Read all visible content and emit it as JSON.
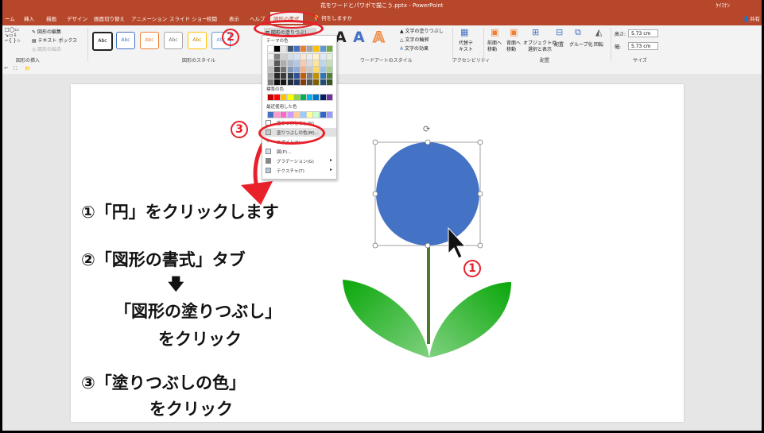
{
  "window": {
    "title": "花をワードとパワポで描こう.pptx  -  PowerPoint",
    "user": "ｹｲﾏﾅﾝ",
    "share": "共有"
  },
  "tabs": [
    "ーム",
    "挿入",
    "描画",
    "デザイン",
    "画面切り替え",
    "アニメーション",
    "スライド ショー",
    "校閲",
    "表示",
    "ヘルプ",
    "図形の書式"
  ],
  "tell_me": "何をしますか",
  "ribbon": {
    "insert_shapes": {
      "edit_shape": "図形の編集",
      "text_box": "テキスト ボックス",
      "merge": "図形の結合",
      "label": "図形の挿入"
    },
    "shape_styles": {
      "style_text": "Abc",
      "label": "図形のスタイル"
    },
    "fill_button": "図形の塗りつぶし",
    "wordart": {
      "fill": "文字の塗りつぶし",
      "outline": "文字の輪郭",
      "effects": "文字の効果",
      "label": "ワードアートのスタイル",
      "letter": "A"
    },
    "accessibility": {
      "alt_text": "代替テ\nキスト",
      "label": "アクセシビリティ"
    },
    "arrange": {
      "forward": "前面へ\n移動",
      "backward": "背面へ\n移動",
      "selection": "オブジェクトの\n選択と表示",
      "align": "配置",
      "group": "グループ化",
      "rotate": "回転",
      "label": "配置"
    },
    "size": {
      "height_label": "高さ:",
      "height": "5.73 cm",
      "width_label": "幅:",
      "width": "5.73 cm",
      "label": "サイズ"
    }
  },
  "dropdown": {
    "theme_colors": "テーマの色",
    "standard_colors": "標準の色",
    "recent_colors": "最近使用した色",
    "no_fill": "塗りつぶしなし(N)",
    "more_colors": "塗りつぶしの色(M)...",
    "eyedropper": "スポイト(E)",
    "picture": "図(P)...",
    "gradient": "グラデーション(G)",
    "texture": "テクスチャ(T)",
    "theme_palette": [
      [
        "#ffffff",
        "#000000",
        "#e7e6e6",
        "#44546a",
        "#4472c4",
        "#ed7d31",
        "#a5a5a5",
        "#ffc000",
        "#5b9bd5",
        "#70ad47"
      ],
      [
        "#f2f2f2",
        "#7f7f7f",
        "#d0cece",
        "#d6dce4",
        "#d9e2f3",
        "#fbe5d5",
        "#ededed",
        "#fff2cc",
        "#deebf6",
        "#e2efd9"
      ],
      [
        "#d8d8d8",
        "#595959",
        "#aeabab",
        "#adb9ca",
        "#b4c6e7",
        "#f7cbac",
        "#dbdbdb",
        "#fee599",
        "#bdd7ee",
        "#c5e0b3"
      ],
      [
        "#bfbfbf",
        "#3f3f3f",
        "#757070",
        "#8496b0",
        "#8eaadb",
        "#f4b183",
        "#c9c9c9",
        "#ffd965",
        "#9cc3e5",
        "#a8d08d"
      ],
      [
        "#a5a5a5",
        "#262626",
        "#3a3838",
        "#323f4f",
        "#2f5496",
        "#c55a11",
        "#7b7b7b",
        "#bf9000",
        "#2e75b5",
        "#538135"
      ],
      [
        "#7f7f7f",
        "#0c0c0c",
        "#171616",
        "#222a35",
        "#1f3864",
        "#833c0b",
        "#525252",
        "#7f6000",
        "#1e4e79",
        "#375623"
      ]
    ],
    "standard_palette": [
      "#c00000",
      "#ff0000",
      "#ffc000",
      "#ffff00",
      "#92d050",
      "#00b050",
      "#00b0f0",
      "#0070c0",
      "#002060",
      "#7030a0"
    ],
    "recent_palette": [
      "#4472c4",
      "#ff99cc",
      "#ff66cc",
      "#cc99ff",
      "#ffcc99",
      "#99ccff",
      "#ffff99",
      "#ccffcc",
      "#3366cc",
      "#9999ff"
    ]
  },
  "slide": {
    "step1": "①「円」をクリックします",
    "step2": "②「図形の書式」タブ",
    "arrow": "🡇",
    "step2b": "「図形の塗りつぶし」",
    "step2c": "をクリック",
    "step3": "③「塗りつぶしの色」",
    "step3b": "をクリック"
  },
  "annotations": {
    "one": "1",
    "two": "2",
    "three": "3"
  },
  "colors": {
    "accent": "#b7472a",
    "circle": "#4472c4",
    "leaf": "#1aa51a",
    "stem": "#4c7a2e",
    "highlight": "#e8202a"
  }
}
